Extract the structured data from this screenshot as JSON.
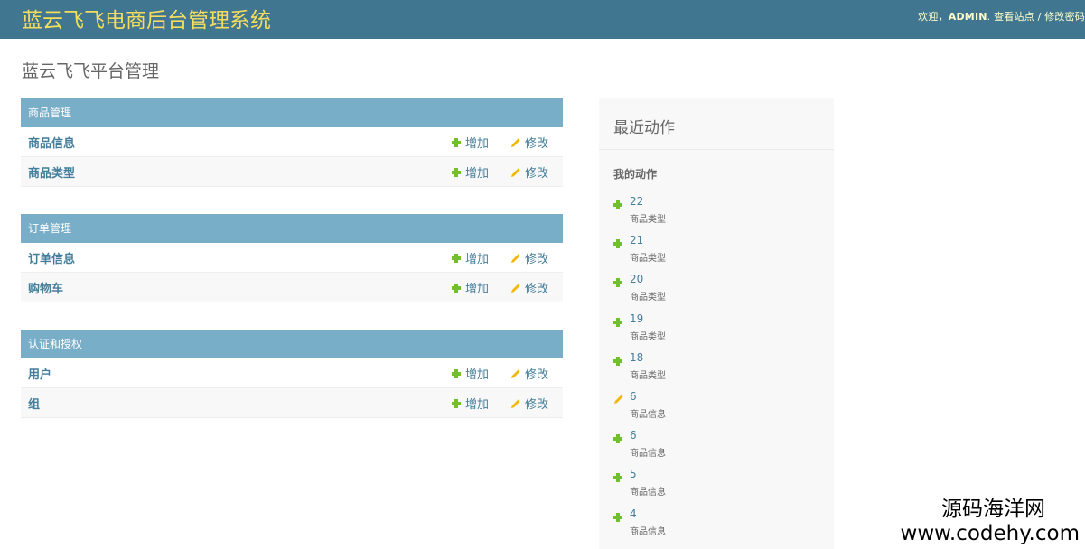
{
  "header": {
    "site_title": "蓝云飞飞电商后台管理系统",
    "welcome": "欢迎，",
    "username": "ADMIN",
    "view_site": "查看站点",
    "separator": "/",
    "change_password": "修改密码"
  },
  "page_title": "蓝云飞飞平台管理",
  "actions": {
    "add": "增加",
    "change": "修改"
  },
  "modules": [
    {
      "caption": "商品管理",
      "models": [
        {
          "name": "商品信息"
        },
        {
          "name": "商品类型"
        }
      ]
    },
    {
      "caption": "订单管理",
      "models": [
        {
          "name": "订单信息"
        },
        {
          "name": "购物车"
        }
      ]
    },
    {
      "caption": "认证和授权",
      "models": [
        {
          "name": "用户"
        },
        {
          "name": "组"
        }
      ]
    }
  ],
  "recent": {
    "title": "最近动作",
    "subtitle": "我的动作",
    "items": [
      {
        "action": "add",
        "id": "22",
        "type": "商品类型"
      },
      {
        "action": "add",
        "id": "21",
        "type": "商品类型"
      },
      {
        "action": "add",
        "id": "20",
        "type": "商品类型"
      },
      {
        "action": "add",
        "id": "19",
        "type": "商品类型"
      },
      {
        "action": "add",
        "id": "18",
        "type": "商品类型"
      },
      {
        "action": "change",
        "id": "6",
        "type": "商品信息"
      },
      {
        "action": "add",
        "id": "6",
        "type": "商品信息"
      },
      {
        "action": "add",
        "id": "5",
        "type": "商品信息"
      },
      {
        "action": "add",
        "id": "4",
        "type": "商品信息"
      }
    ]
  },
  "watermark": {
    "name": "源码海洋网",
    "url": "www.codehy.com"
  },
  "colors": {
    "header_bg": "#417690",
    "module_caption_bg": "#79aec8",
    "link": "#447e9b",
    "add_green": "#70bf2b",
    "change_yellow": "#efb80b"
  }
}
